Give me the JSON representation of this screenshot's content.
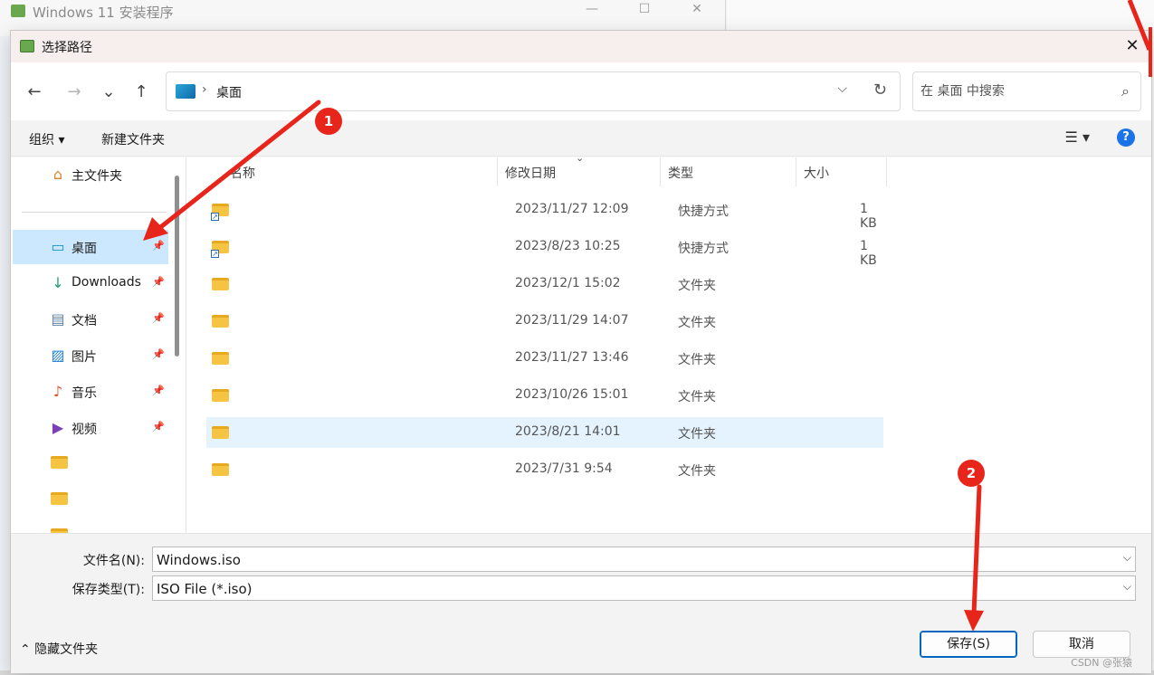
{
  "background_window": {
    "title": "Windows 11 安装程序"
  },
  "dialog": {
    "title": "选择路径",
    "close_symbol": "✕",
    "nav": {
      "back": "←",
      "forward": "→",
      "recent": "⌄",
      "up": "↑"
    },
    "address": {
      "separator": "›",
      "location": "桌面",
      "dropdown": "⌵",
      "refresh": "↻"
    },
    "search": {
      "placeholder": "在 桌面 中搜索",
      "icon": "⌕"
    },
    "toolbar": {
      "organize": "组织 ▾",
      "new_folder": "新建文件夹",
      "view": "☰ ▾",
      "help": "?"
    },
    "sidebar": {
      "home": {
        "icon": "⌂",
        "label": "主文件夹"
      },
      "items": [
        {
          "icon": "▭",
          "label": "桌面",
          "pin": "📌",
          "selected": true
        },
        {
          "icon": "↓",
          "label": "Downloads",
          "pin": "📌"
        },
        {
          "icon": "▤",
          "label": "文档",
          "pin": "📌"
        },
        {
          "icon": "▨",
          "label": "图片",
          "pin": "📌"
        },
        {
          "icon": "♪",
          "label": "音乐",
          "pin": "📌"
        },
        {
          "icon": "▶",
          "label": "视频",
          "pin": "📌"
        }
      ]
    },
    "columns": {
      "name": "名称",
      "modified": "修改日期",
      "type": "类型",
      "size": "大小",
      "sort": "⌄"
    },
    "files": [
      {
        "modified": "2023/11/27 12:09",
        "type": "快捷方式",
        "size": "1 KB",
        "shortcut": true
      },
      {
        "modified": "2023/8/23 10:25",
        "type": "快捷方式",
        "size": "1 KB",
        "shortcut": true
      },
      {
        "modified": "2023/12/1 15:02",
        "type": "文件夹",
        "size": ""
      },
      {
        "modified": "2023/11/29 14:07",
        "type": "文件夹",
        "size": ""
      },
      {
        "modified": "2023/11/27 13:46",
        "type": "文件夹",
        "size": ""
      },
      {
        "modified": "2023/10/26 15:01",
        "type": "文件夹",
        "size": ""
      },
      {
        "modified": "2023/8/21 14:01",
        "type": "文件夹",
        "size": "",
        "selected": true
      },
      {
        "modified": "2023/7/31 9:54",
        "type": "文件夹",
        "size": ""
      }
    ],
    "form": {
      "filename_label": "文件名(N):",
      "filename_value": "Windows.iso",
      "filetype_label": "保存类型(T):",
      "filetype_value": "ISO File (*.iso)",
      "dropdown": "⌵",
      "hide_folders": "⌃ 隐藏文件夹",
      "save": "保存(S)",
      "cancel": "取消"
    }
  },
  "annotations": {
    "step1": "1",
    "step2": "2",
    "color": "#e8251b"
  },
  "watermark": "CSDN @张猿"
}
